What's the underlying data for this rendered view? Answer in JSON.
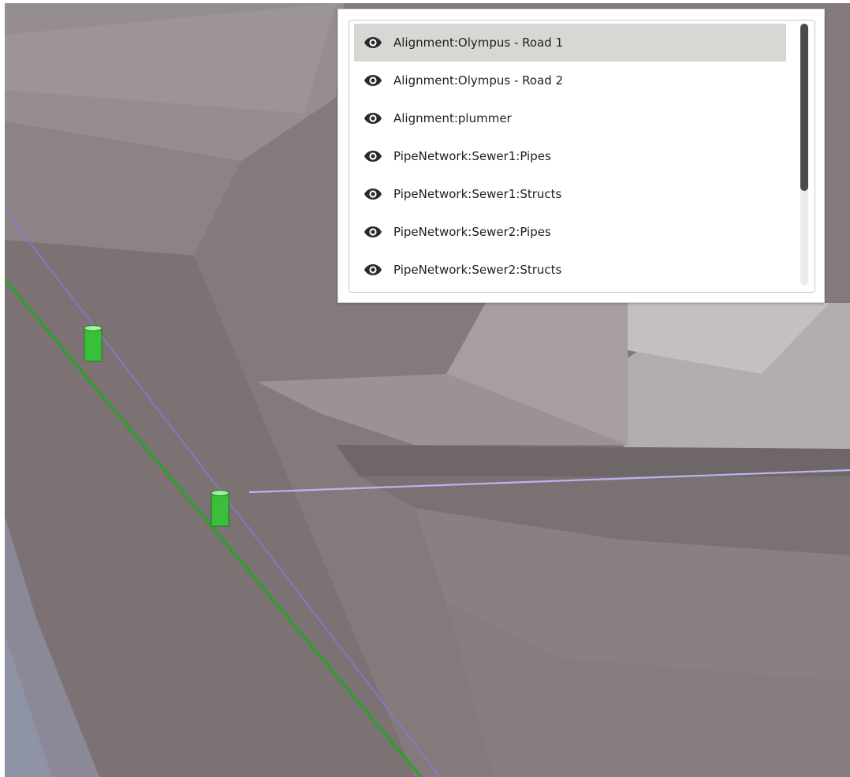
{
  "viewport": {
    "background_color": "#857b7c",
    "alignment_line_color": "#7d7ce0",
    "pipe_color": "#2f9e2f",
    "structure_color": "#3bbf3b"
  },
  "layer_panel": {
    "selected_index": 0,
    "scroll_position": 0.0,
    "items": [
      {
        "label": "Alignment:Olympus - Road 1",
        "icon": "eye-icon",
        "visible": true
      },
      {
        "label": "Alignment:Olympus - Road 2",
        "icon": "eye-icon",
        "visible": true
      },
      {
        "label": "Alignment:plummer",
        "icon": "eye-icon",
        "visible": true
      },
      {
        "label": "PipeNetwork:Sewer1:Pipes",
        "icon": "eye-icon",
        "visible": true
      },
      {
        "label": "PipeNetwork:Sewer1:Structs",
        "icon": "eye-icon",
        "visible": true
      },
      {
        "label": "PipeNetwork:Sewer2:Pipes",
        "icon": "eye-icon",
        "visible": true
      },
      {
        "label": "PipeNetwork:Sewer2:Structs",
        "icon": "eye-icon",
        "visible": true
      }
    ]
  }
}
